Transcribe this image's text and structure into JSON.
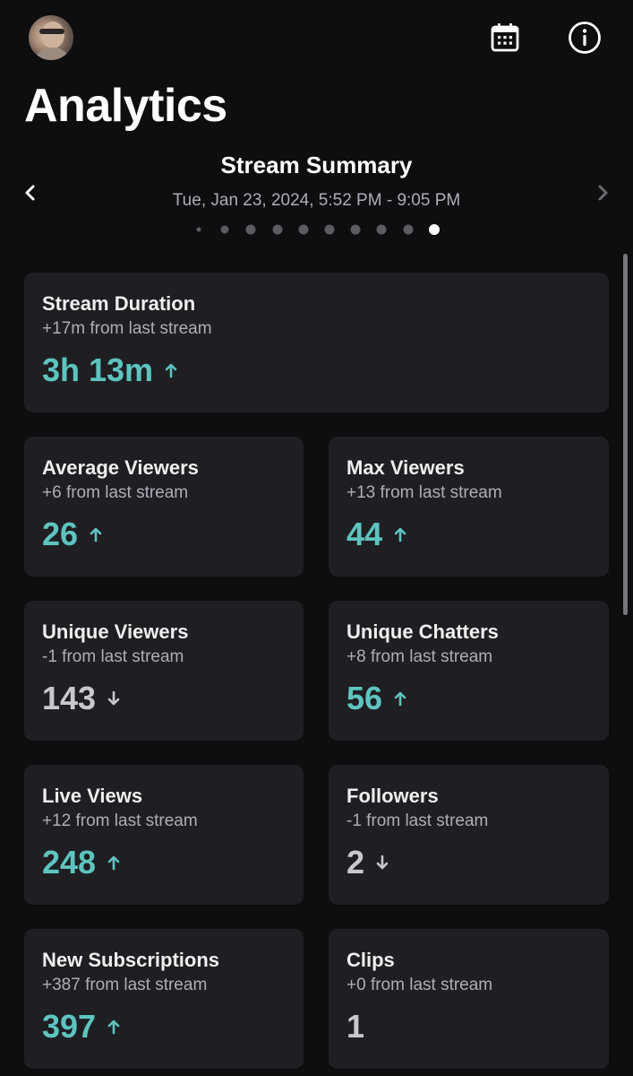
{
  "header": {
    "title": "Analytics",
    "avatar_icon": "user-avatar",
    "calendar_icon": "calendar-icon",
    "info_icon": "info-icon"
  },
  "summary": {
    "title": "Stream Summary",
    "date_range": "Tue, Jan 23, 2024, 5:52 PM - 9:05 PM",
    "page_count": 10,
    "active_page_index": 9
  },
  "colors": {
    "background": "#0e0e10",
    "card": "#1f1f23",
    "accent_up": "#5ec4bf",
    "neutral": "#c8c8cf"
  },
  "metrics": {
    "stream_duration": {
      "title": "Stream Duration",
      "change": "+17m from last stream",
      "value": "3h 13m",
      "trend": "up"
    },
    "average_viewers": {
      "title": "Average Viewers",
      "change": "+6 from last stream",
      "value": "26",
      "trend": "up"
    },
    "max_viewers": {
      "title": "Max Viewers",
      "change": "+13 from last stream",
      "value": "44",
      "trend": "up"
    },
    "unique_viewers": {
      "title": "Unique Viewers",
      "change": "-1 from last stream",
      "value": "143",
      "trend": "down"
    },
    "unique_chatters": {
      "title": "Unique Chatters",
      "change": "+8 from last stream",
      "value": "56",
      "trend": "up"
    },
    "live_views": {
      "title": "Live Views",
      "change": "+12 from last stream",
      "value": "248",
      "trend": "up"
    },
    "followers": {
      "title": "Followers",
      "change": "-1 from last stream",
      "value": "2",
      "trend": "down"
    },
    "new_subscriptions": {
      "title": "New Subscriptions",
      "change": "+387 from last stream",
      "value": "397",
      "trend": "up"
    },
    "clips": {
      "title": "Clips",
      "change": "+0 from last stream",
      "value": "1",
      "trend": "none"
    }
  }
}
